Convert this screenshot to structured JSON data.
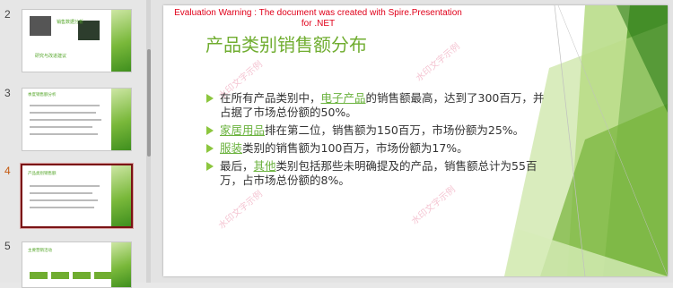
{
  "thumbnails": [
    {
      "number": "2",
      "title": "销售数据分析",
      "subtitle": "研究与改进建议",
      "active": false
    },
    {
      "number": "3",
      "title": "季度销售额分析",
      "active": false
    },
    {
      "number": "4",
      "title": "产品类别销售额",
      "active": true
    },
    {
      "number": "5",
      "title": "主要营销活动",
      "active": false
    }
  ],
  "slide": {
    "warning_line1": "Evaluation Warning : The document was created with  Spire.Presentation",
    "warning_line2": "for .NET",
    "title": "产品类别销售额分布",
    "watermark": "水印文字示例",
    "bullets": [
      {
        "pre": "在所有产品类别中，",
        "keyword": "电子产品",
        "post": "的销售额最高，达到了300百万，并占据了市场总份额的50%。"
      },
      {
        "pre": "",
        "keyword": "家居用品",
        "post": "排在第二位，销售额为150百万，市场份额为25%。"
      },
      {
        "pre": "",
        "keyword": "服装",
        "post": "类别的销售额为100百万，市场份额为17%。"
      },
      {
        "pre": "最后，",
        "keyword": "其他",
        "post": "类别包括那些未明确提及的产品，销售额总计为55百万，占市场总份额的8%。"
      }
    ]
  },
  "colors": {
    "accent": "#70ad30",
    "warning": "#e0001a",
    "active_border": "#7a1315"
  }
}
